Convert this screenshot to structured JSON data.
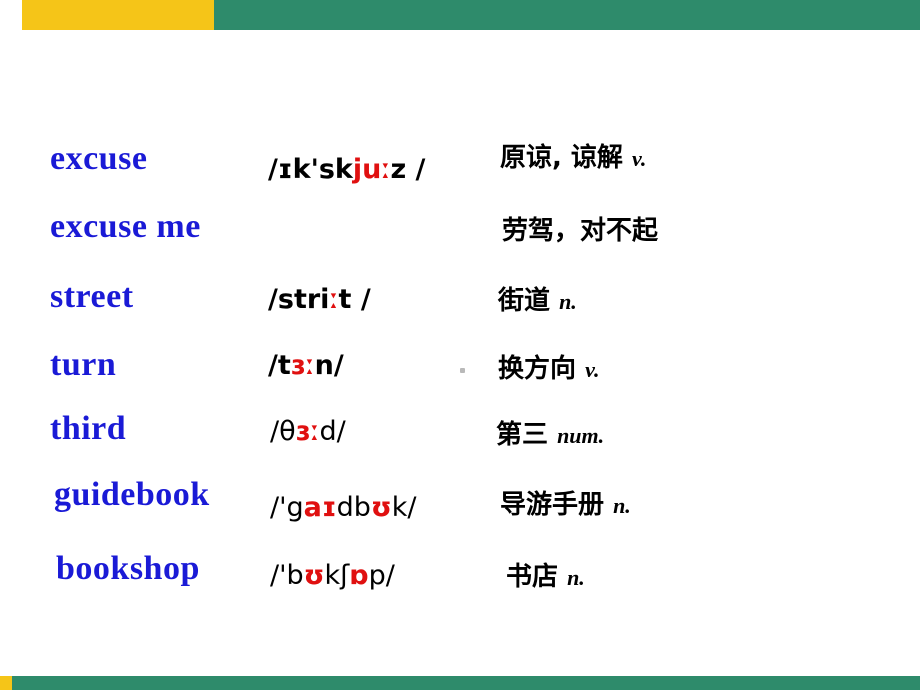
{
  "slide": {
    "decor": {
      "top_bar_color": "#2e8b6b",
      "top_accent_color": "#f5c518",
      "bottom_bar_color": "#2e8b6b"
    },
    "rows": [
      {
        "word": "excuse",
        "phonetic_parts": [
          {
            "text": "/",
            "style": "plain"
          },
          {
            "text": "ɪ",
            "style": "bold"
          },
          {
            "text": "k'sk",
            "style": "bold"
          },
          {
            "text": "juː",
            "style": "red"
          },
          {
            "text": "z /",
            "style": "bold"
          }
        ],
        "phonetic_plain": "/ɪk'skjuːz /",
        "meaning": "原谅, 谅解 ",
        "pos": "v."
      },
      {
        "word": "excuse me",
        "phonetic_parts": [],
        "phonetic_plain": "",
        "meaning": " 劳驾，对不起",
        "pos": ""
      },
      {
        "word": "street",
        "phonetic_parts": [
          {
            "text": "/",
            "style": "plain"
          },
          {
            "text": "stri",
            "style": "bold"
          },
          {
            "text": "ː",
            "style": "red"
          },
          {
            "text": "t /",
            "style": "bold"
          }
        ],
        "phonetic_plain": "/striːt /",
        "meaning": "街道 ",
        "pos": "n."
      },
      {
        "word": "turn",
        "phonetic_parts": [
          {
            "text": "/",
            "style": "plain"
          },
          {
            "text": "t",
            "style": "bold"
          },
          {
            "text": "ɜː",
            "style": "red"
          },
          {
            "text": "n/",
            "style": "bold"
          }
        ],
        "phonetic_plain": "/tɜːn/",
        "meaning": "换方向  ",
        "pos": "v."
      },
      {
        "word": "third",
        "phonetic_parts": [
          {
            "text": "/θ",
            "style": "plain"
          },
          {
            "text": "ɜː",
            "style": "red"
          },
          {
            "text": "d/",
            "style": "plain"
          }
        ],
        "phonetic_plain": "/θɜːd/",
        "meaning": "第三  ",
        "pos": "num."
      },
      {
        "word": "guidebook",
        "phonetic_parts": [
          {
            "text": "/'g",
            "style": "plain"
          },
          {
            "text": "a",
            "style": "red"
          },
          {
            "text": "ɪ",
            "style": "red"
          },
          {
            "text": "db",
            "style": "plain"
          },
          {
            "text": "ʊ",
            "style": "red"
          },
          {
            "text": "k/",
            "style": "plain"
          }
        ],
        "phonetic_plain": "/'gaɪdbʊk/",
        "meaning": "导游手册 ",
        "pos": "n."
      },
      {
        "word": "bookshop",
        "phonetic_parts": [
          {
            "text": "/'b",
            "style": "plain"
          },
          {
            "text": "ʊ",
            "style": "red"
          },
          {
            "text": "kʃ",
            "style": "plain"
          },
          {
            "text": "ɒ",
            "style": "red"
          },
          {
            "text": "p/",
            "style": "plain"
          }
        ],
        "phonetic_plain": "/'bʊkʃɒp/",
        "meaning": " 书店 ",
        "pos": "n."
      }
    ]
  }
}
